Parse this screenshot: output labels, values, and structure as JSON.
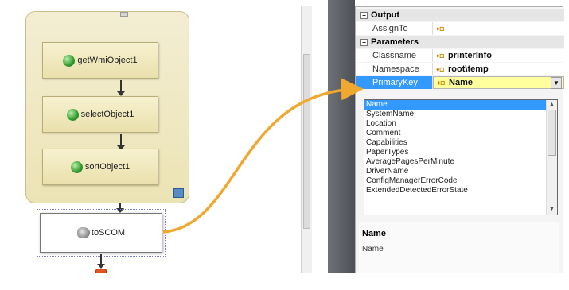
{
  "workflow": {
    "activities": [
      {
        "label": "getWmiObject1",
        "icon": "globe-icon"
      },
      {
        "label": "selectObject1",
        "icon": "globe-icon"
      },
      {
        "label": "sortObject1",
        "icon": "globe-icon"
      }
    ],
    "scom_activity": {
      "label": "toSCOM",
      "icon": "scom-icon"
    },
    "colors": {
      "sequence_fill": "#ece3b4",
      "connector": "#f0a830",
      "end_node": "#e2521e"
    }
  },
  "property_grid": {
    "output_category": "Output",
    "output_rows": [
      {
        "name": "AssignTo",
        "value": ""
      }
    ],
    "parameters_category": "Parameters",
    "parameter_rows": [
      {
        "name": "Classname",
        "value": "printerInfo"
      },
      {
        "name": "Namespace",
        "value": "root\\temp"
      },
      {
        "name": "PrimaryKey",
        "value": "Name"
      }
    ],
    "dropdown_options": [
      "Name",
      "SystemName",
      "Location",
      "Comment",
      "Capabilities",
      "PaperTypes",
      "AveragePagesPerMinute",
      "DriverName",
      "ConfigManagerErrorCode",
      "ExtendedDetectedErrorState"
    ],
    "description": {
      "title": "Name",
      "text": "Name"
    }
  }
}
